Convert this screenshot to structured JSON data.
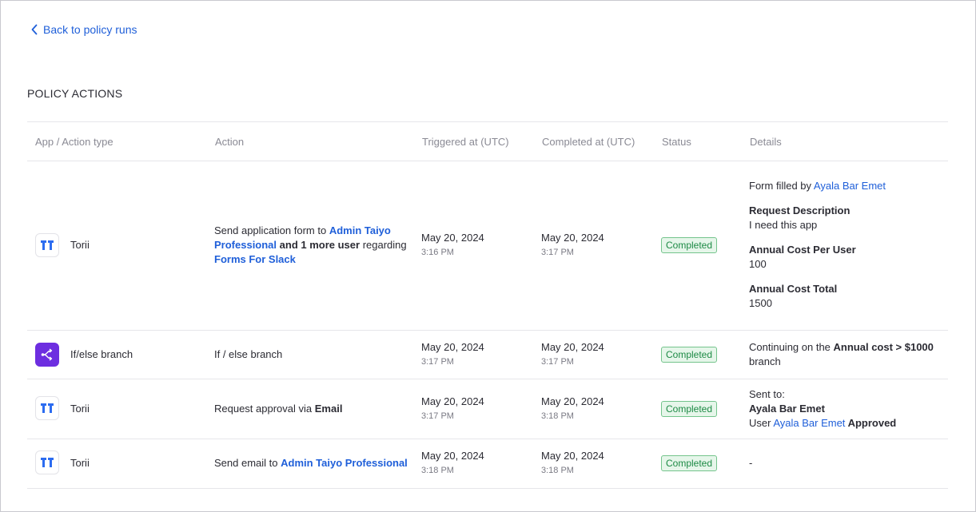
{
  "back_link": "Back to policy runs",
  "section_title": "POLICY ACTIONS",
  "columns": {
    "app": "App / Action type",
    "action": "Action",
    "triggered": "Triggered at (UTC)",
    "completed": "Completed at (UTC)",
    "status": "Status",
    "details": "Details"
  },
  "rows": [
    {
      "app_name": "Torii",
      "icon": "torii-logo-icon",
      "action": {
        "prefix": "Send application form to ",
        "recipient": "Admin Taiyo Professional",
        "and_more": " and 1 more user",
        "regarding": " regarding ",
        "app": "Forms For Slack"
      },
      "triggered_date": "May 20, 2024",
      "triggered_time": "3:16 PM",
      "completed_date": "May 20, 2024",
      "completed_time": "3:17 PM",
      "status": "Completed",
      "details": {
        "filled_prefix": "Form filled by ",
        "filled_by": "Ayala Bar Emet",
        "f1_label": "Request Description",
        "f1_value": "I need this app",
        "f2_label": "Annual Cost Per User",
        "f2_value": "100",
        "f3_label": "Annual Cost Total",
        "f3_value": "1500"
      }
    },
    {
      "app_name": "If/else branch",
      "icon": "branch-icon",
      "action": {
        "text": "If / else branch"
      },
      "triggered_date": "May 20, 2024",
      "triggered_time": "3:17 PM",
      "completed_date": "May 20, 2024",
      "completed_time": "3:17 PM",
      "status": "Completed",
      "details": {
        "prefix": "Continuing on the ",
        "condition": "Annual cost > $1000",
        "suffix": "branch"
      }
    },
    {
      "app_name": "Torii",
      "icon": "torii-logo-icon",
      "action": {
        "prefix": "Request approval via ",
        "channel": "Email"
      },
      "triggered_date": "May 20, 2024",
      "triggered_time": "3:17 PM",
      "completed_date": "May 20, 2024",
      "completed_time": "3:18 PM",
      "status": "Completed",
      "details": {
        "sent_to_label": "Sent to:",
        "sent_to": "Ayala Bar Emet",
        "user_prefix": "User ",
        "user": "Ayala Bar Emet",
        "result": " Approved"
      }
    },
    {
      "app_name": "Torii",
      "icon": "torii-logo-icon",
      "action": {
        "prefix": "Send email to ",
        "recipient": "Admin Taiyo Professional"
      },
      "triggered_date": "May 20, 2024",
      "triggered_time": "3:18 PM",
      "completed_date": "May 20, 2024",
      "completed_time": "3:18 PM",
      "status": "Completed",
      "details": {
        "text": "-"
      }
    }
  ],
  "colors": {
    "link": "#1f5fd9",
    "badge_text": "#1d8a45",
    "badge_bg": "#e6f6ea",
    "branch_icon_bg": "#6d2ee0",
    "torii_blue": "#2c6cf0"
  }
}
